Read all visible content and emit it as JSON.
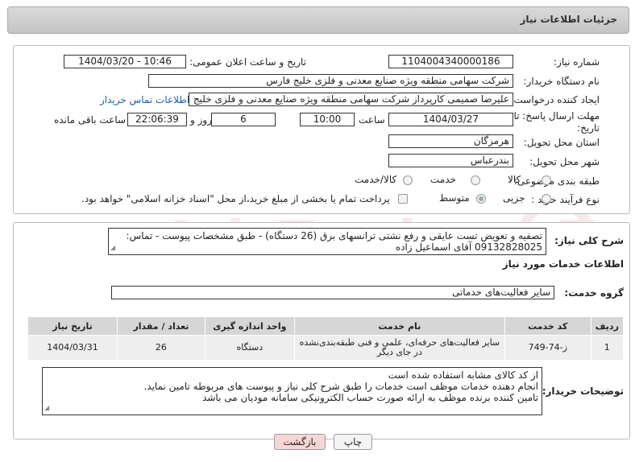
{
  "header": {
    "title": "جزئیات اطلاعات نیاز"
  },
  "form": {
    "need_number_label": "شماره نیاز:",
    "need_number": "1104004340000186",
    "announce_datetime_label": "تاریخ و ساعت اعلان عمومی:",
    "announce_datetime": "1404/03/20 - 10:46",
    "buyer_org_label": "نام دستگاه خریدار:",
    "buyer_org": "شرکت سهامی منطقه ویژه صنایع معدنی و فلزی خلیج فارس",
    "requester_label": "ایجاد کننده درخواست:",
    "requester": "علیرضا صمیمی کارپرداز شرکت سهامی منطقه ویژه صنایع معدنی و فلزی خلیج فارس",
    "contact_link": "اطلاعات تماس خریدار",
    "deadline_label_1": "مهلت ارسال پاسخ: تا",
    "deadline_label_2": "تاریخ:",
    "deadline_date": "1404/03/27",
    "time_label": "ساعت",
    "deadline_time": "10:00",
    "days_value": "6",
    "days_label": "روز و",
    "remaining_time": "22:06:39",
    "remaining_label": "ساعت باقی مانده",
    "province_label": "استان محل تحویل:",
    "province": "هرمزگان",
    "city_label": "شهر محل تحویل:",
    "city": "بندرعباس",
    "category_label": "طبقه بندی موضوعی:",
    "category_options": [
      "کالا",
      "خدمت",
      "کالا/خدمت"
    ],
    "category_selected": "خدمت",
    "process_label": "نوع فرآیند خرید :",
    "process_options": [
      "جزیی",
      "متوسط"
    ],
    "process_selected": "متوسط",
    "treasury_note": "پرداخت تمام یا بخشی از مبلغ خرید،از محل \"اسناد خزانه اسلامی\" خواهد بود."
  },
  "summary": {
    "label": "شرح کلی نیاز:",
    "text": "تصفیه و تعویض تست عایقی و رفع نشتی ترانسهای برق (26 دستگاه) - طبق مشخصات پیوست - تماس: 09132828025 آقای اسماعیل زاده"
  },
  "services": {
    "section_title": "اطلاعات خدمات مورد نیاز",
    "group_label": "گروه خدمت:",
    "group_value": "سایر فعالیت‌های خدماتی",
    "table": {
      "headers": [
        "ردیف",
        "کد خدمت",
        "نام خدمت",
        "واحد اندازه گیری",
        "تعداد / مقدار",
        "تاریخ نیاز"
      ],
      "rows": [
        [
          "1",
          "ز-74-749",
          "سایر فعالیت‌های حرفه‌ای، علمی و فنی طبقه‌بندی‌نشده در جای دیگر",
          "دستگاه",
          "26",
          "1404/03/31"
        ]
      ]
    }
  },
  "buyer_notes": {
    "label": "توضیحات خریدار:",
    "lines": [
      "از کد کالای مشابه استفاده شده است",
      "انجام دهنده خدمات موظف است خدمات را طبق شرح کلی نیاز و پیوست های مربوطه تامین نماید.",
      "تامین کننده برنده موظف به ارائه صورت حساب الکترونیکی سامانه مودیان می باشد"
    ]
  },
  "buttons": {
    "print": "چاپ",
    "back": "بازگشت"
  },
  "watermark_text": "AriaTender.neT",
  "colors": {
    "link": "#1a5fb4",
    "back_button_bg": "#f7d6d6",
    "watermark": "#c0392b"
  }
}
